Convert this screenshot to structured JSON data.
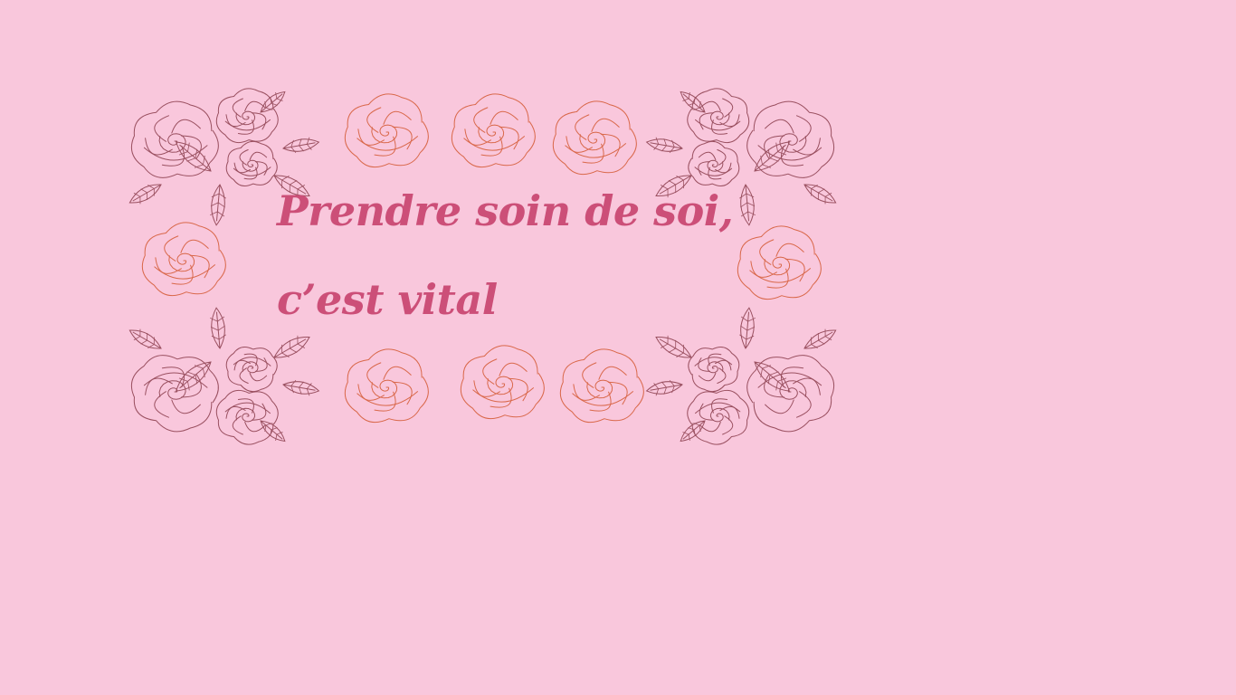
{
  "page": {
    "background_color": "#f9c7dc"
  },
  "quote": {
    "line1": "Prendre soin de soi,",
    "line2": "c’est vital",
    "color": "#cc4f78"
  },
  "decoration": {
    "frame_icon": "rose-bouquet-icon",
    "single_icon": "rose-icon",
    "bouquet_stroke": "#9a5060",
    "single_stroke": "#d9684a"
  }
}
